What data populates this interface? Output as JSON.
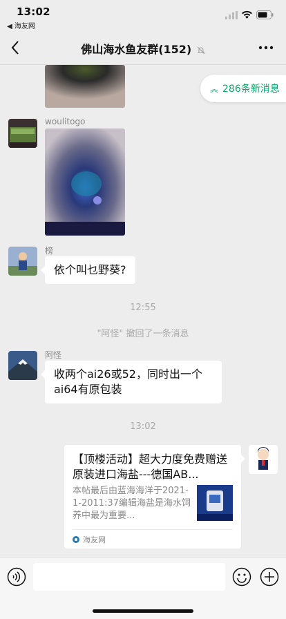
{
  "status_bar": {
    "time": "13:02",
    "back_app": "◀ 海友网"
  },
  "navbar": {
    "title": "佛山海水鱼友群(152)"
  },
  "new_messages": {
    "label": "286条新消息"
  },
  "messages": {
    "woulitogo": {
      "nick": "woulitogo"
    },
    "bang": {
      "nick": "榜",
      "text": "依个叫乜野葵?"
    },
    "time1": "12:55",
    "recall": "\"阿怪\" 撤回了一条消息",
    "aguai": {
      "nick": "阿怪",
      "text": "收两个ai26或52，同时出一个ai64有原包装"
    },
    "time2": "13:02",
    "link_card": {
      "title": "【顶楼活动】超大力度免费赠送原装进口海盐---德国AB...",
      "desc": "本帖最后由蓝海海洋于2021-1-2011:37编辑海盐是海水饲养中最为重要...",
      "source": "海友网"
    }
  },
  "colors": {
    "accent_green": "#07a868",
    "background": "#ededed",
    "bubble": "#ffffff"
  }
}
